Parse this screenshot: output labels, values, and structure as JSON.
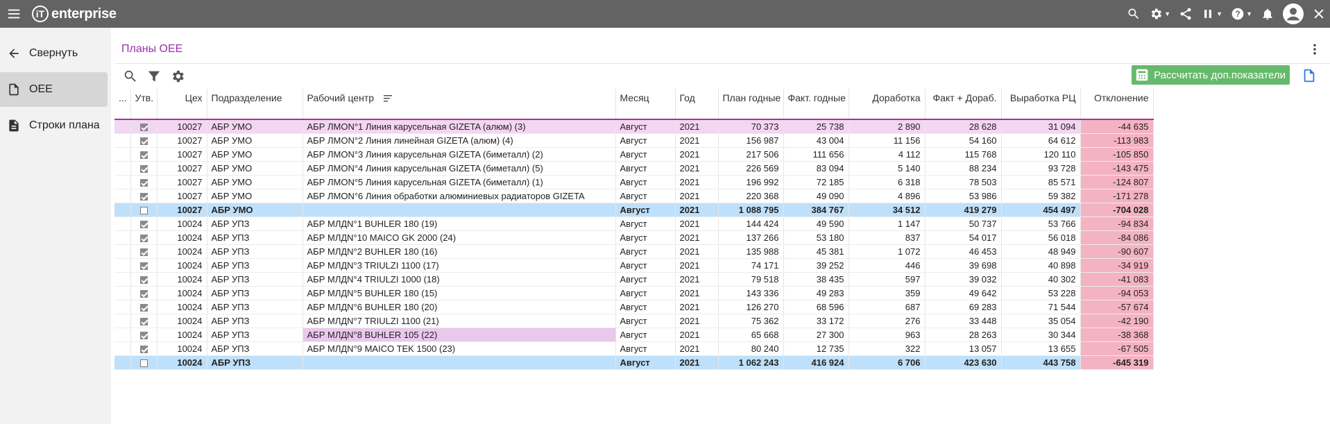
{
  "app": {
    "logo_text": "enterprise",
    "logo_mark": "iT"
  },
  "sidebar": {
    "items": [
      {
        "label": "Свернуть",
        "icon": "arrow-back-icon"
      },
      {
        "label": "OEE",
        "icon": "document-icon"
      },
      {
        "label": "Строки плана",
        "icon": "document-lines-icon"
      }
    ]
  },
  "page": {
    "title": "Планы OEE"
  },
  "toolbar": {
    "calc_label": "Рассчитать доп.показатели"
  },
  "table": {
    "headers": {
      "dots": "...",
      "utv": "Утв.",
      "tseh": "Цех",
      "podr": "Подразделение",
      "rc": "Рабочий центр",
      "month": "Месяц",
      "year": "Год",
      "plan": "План годные",
      "fact": "Факт. годные",
      "dorab": "Доработка",
      "fact_dorab": "Факт + Дораб.",
      "vyr": "Выработка РЦ",
      "otkl": "Отклонение"
    },
    "rows": [
      {
        "checked": true,
        "tseh": "10027",
        "podr": "АБР УМО",
        "rc": "АБР ЛМОN°1 Линия карусельная GIZETA (алюм) (3)",
        "month": "Август",
        "year": "2021",
        "plan": "70 373",
        "fact": "25 738",
        "dorab": "2 890",
        "fact_dorab": "28 628",
        "vyr": "31 094",
        "otkl": "-44 635",
        "type": "selected"
      },
      {
        "checked": true,
        "tseh": "10027",
        "podr": "АБР УМО",
        "rc": "АБР ЛМОN°2 Линия линейная GIZETA (алюм) (4)",
        "month": "Август",
        "year": "2021",
        "plan": "156 987",
        "fact": "43 004",
        "dorab": "11 156",
        "fact_dorab": "54 160",
        "vyr": "64 612",
        "otkl": "-113 983",
        "type": "normal"
      },
      {
        "checked": true,
        "tseh": "10027",
        "podr": "АБР УМО",
        "rc": "АБР ЛМОN°3 Линия карусельная GIZETA (биметалл) (2)",
        "month": "Август",
        "year": "2021",
        "plan": "217 506",
        "fact": "111 656",
        "dorab": "4 112",
        "fact_dorab": "115 768",
        "vyr": "120 110",
        "otkl": "-105 850",
        "type": "normal"
      },
      {
        "checked": true,
        "tseh": "10027",
        "podr": "АБР УМО",
        "rc": "АБР ЛМОN°4 Линия карусельная GIZETA (биметалл) (5)",
        "month": "Август",
        "year": "2021",
        "plan": "226 569",
        "fact": "83 094",
        "dorab": "5 140",
        "fact_dorab": "88 234",
        "vyr": "93 728",
        "otkl": "-143 475",
        "type": "normal"
      },
      {
        "checked": true,
        "tseh": "10027",
        "podr": "АБР УМО",
        "rc": "АБР ЛМОN°5 Линия карусельная GIZETA (биметалл) (1)",
        "month": "Август",
        "year": "2021",
        "plan": "196 992",
        "fact": "72 185",
        "dorab": "6 318",
        "fact_dorab": "78 503",
        "vyr": "85 571",
        "otkl": "-124 807",
        "type": "normal"
      },
      {
        "checked": true,
        "tseh": "10027",
        "podr": "АБР УМО",
        "rc": "АБР ЛМОN°6 Линия обработки алюминиевых радиаторов GIZETA",
        "month": "Август",
        "year": "2021",
        "plan": "220 368",
        "fact": "49 090",
        "dorab": "4 896",
        "fact_dorab": "53 986",
        "vyr": "59 382",
        "otkl": "-171 278",
        "type": "normal"
      },
      {
        "checked": false,
        "tseh": "10027",
        "podr": "АБР УМО",
        "rc": "",
        "month": "Август",
        "year": "2021",
        "plan": "1 088 795",
        "fact": "384 767",
        "dorab": "34 512",
        "fact_dorab": "419 279",
        "vyr": "454 497",
        "otkl": "-704 028",
        "type": "total"
      },
      {
        "checked": true,
        "tseh": "10024",
        "podr": "АБР УПЗ",
        "rc": "АБР МЛДN°1 BUHLER 180 (19)",
        "month": "Август",
        "year": "2021",
        "plan": "144 424",
        "fact": "49 590",
        "dorab": "1 147",
        "fact_dorab": "50 737",
        "vyr": "53 766",
        "otkl": "-94 834",
        "type": "normal"
      },
      {
        "checked": true,
        "tseh": "10024",
        "podr": "АБР УПЗ",
        "rc": "АБР МЛДN°10 MAICO GK 2000 (24)",
        "month": "Август",
        "year": "2021",
        "plan": "137 266",
        "fact": "53 180",
        "dorab": "837",
        "fact_dorab": "54 017",
        "vyr": "56 018",
        "otkl": "-84 086",
        "type": "normal"
      },
      {
        "checked": true,
        "tseh": "10024",
        "podr": "АБР УПЗ",
        "rc": "АБР МЛДN°2 BUHLER 180 (16)",
        "month": "Август",
        "year": "2021",
        "plan": "135 988",
        "fact": "45 381",
        "dorab": "1 072",
        "fact_dorab": "46 453",
        "vyr": "48 949",
        "otkl": "-90 607",
        "type": "normal"
      },
      {
        "checked": true,
        "tseh": "10024",
        "podr": "АБР УПЗ",
        "rc": "АБР МЛДN°3 TRIULZI 1100 (17)",
        "month": "Август",
        "year": "2021",
        "plan": "74 171",
        "fact": "39 252",
        "dorab": "446",
        "fact_dorab": "39 698",
        "vyr": "40 898",
        "otkl": "-34 919",
        "type": "normal"
      },
      {
        "checked": true,
        "tseh": "10024",
        "podr": "АБР УПЗ",
        "rc": "АБР МЛДN°4 TRIULZI 1000 (18)",
        "month": "Август",
        "year": "2021",
        "plan": "79 518",
        "fact": "38 435",
        "dorab": "597",
        "fact_dorab": "39 032",
        "vyr": "40 302",
        "otkl": "-41 083",
        "type": "normal"
      },
      {
        "checked": true,
        "tseh": "10024",
        "podr": "АБР УПЗ",
        "rc": "АБР МЛДN°5 BUHLER 180 (15)",
        "month": "Август",
        "year": "2021",
        "plan": "143 336",
        "fact": "49 283",
        "dorab": "359",
        "fact_dorab": "49 642",
        "vyr": "53 228",
        "otkl": "-94 053",
        "type": "normal"
      },
      {
        "checked": true,
        "tseh": "10024",
        "podr": "АБР УПЗ",
        "rc": "АБР МЛДN°6 BUHLER 180 (20)",
        "month": "Август",
        "year": "2021",
        "plan": "126 270",
        "fact": "68 596",
        "dorab": "687",
        "fact_dorab": "69 283",
        "vyr": "71 544",
        "otkl": "-57 674",
        "type": "normal"
      },
      {
        "checked": true,
        "tseh": "10024",
        "podr": "АБР УПЗ",
        "rc": "АБР МЛДN°7 TRIULZI 1100 (21)",
        "month": "Август",
        "year": "2021",
        "plan": "75 362",
        "fact": "33 172",
        "dorab": "276",
        "fact_dorab": "33 448",
        "vyr": "35 054",
        "otkl": "-42 190",
        "type": "normal"
      },
      {
        "checked": true,
        "tseh": "10024",
        "podr": "АБР УПЗ",
        "rc": "АБР МЛДN°8 BUHLER 105 (22)",
        "month": "Август",
        "year": "2021",
        "plan": "65 668",
        "fact": "27 300",
        "dorab": "963",
        "fact_dorab": "28 263",
        "vyr": "30 344",
        "otkl": "-38 368",
        "type": "hover"
      },
      {
        "checked": true,
        "tseh": "10024",
        "podr": "АБР УПЗ",
        "rc": "АБР МЛДN°9 MAICO TEK 1500 (23)",
        "month": "Август",
        "year": "2021",
        "plan": "80 240",
        "fact": "12 735",
        "dorab": "322",
        "fact_dorab": "13 057",
        "vyr": "13 655",
        "otkl": "-67 505",
        "type": "normal"
      },
      {
        "checked": false,
        "tseh": "10024",
        "podr": "АБР УПЗ",
        "rc": "",
        "month": "Август",
        "year": "2021",
        "plan": "1 062 243",
        "fact": "416 924",
        "dorab": "6 706",
        "fact_dorab": "423 630",
        "vyr": "443 758",
        "otkl": "-645 319",
        "type": "total"
      }
    ]
  }
}
